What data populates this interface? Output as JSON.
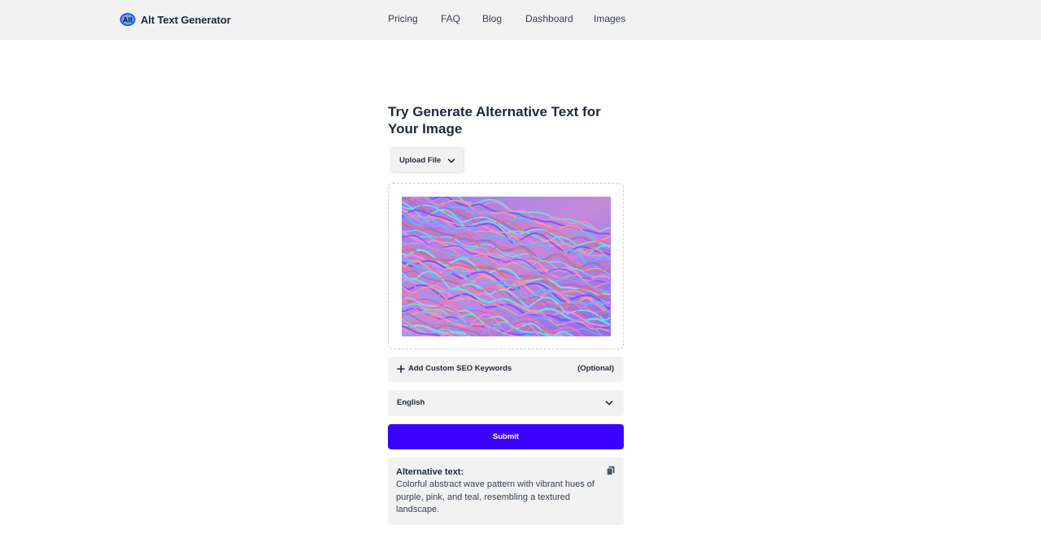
{
  "header": {
    "brand": {
      "logo_icon": "alt-logo-icon",
      "name": "Alt Text Generator"
    },
    "nav": [
      {
        "label": "Pricing"
      },
      {
        "label": "FAQ"
      },
      {
        "label": "Blog"
      },
      {
        "label": "Dashboard"
      },
      {
        "label": "Images"
      }
    ]
  },
  "main": {
    "title": "Try Generate Alternative Text for Your Image",
    "upload": {
      "label": "Upload File",
      "icon": "chevron-down-icon"
    },
    "preview": {
      "description_icon": "abstract-wave-image"
    },
    "seo": {
      "icon": "plus-icon",
      "label": "Add Custom SEO Keywords",
      "optional": "(Optional)"
    },
    "language": {
      "selected": "English",
      "icon": "chevron-down-icon"
    },
    "submit_label": "Submit",
    "result": {
      "label": "Alternative text:",
      "text": "Colorful abstract wave pattern with vibrant hues of purple, pink, and teal, resembling a textured landscape.",
      "copy_icon": "copy-icon"
    }
  },
  "colors": {
    "header_bg": "#f2f2f2",
    "accent": "#3b00ff",
    "panel_bg": "#f2f2f2",
    "text": "#1e293b"
  }
}
